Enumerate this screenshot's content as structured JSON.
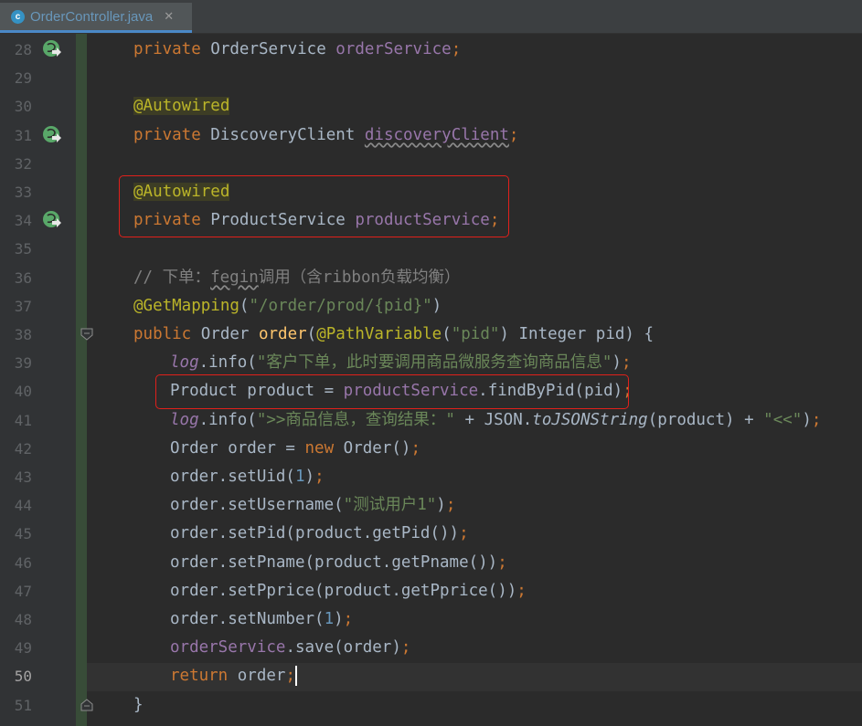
{
  "editor": {
    "tab": {
      "filename": "OrderController.java",
      "icon_letter": "c",
      "close_glyph": "✕"
    },
    "active_line": "50",
    "lines": [
      {
        "n": "28",
        "parts": [
          [
            "kw",
            "private "
          ],
          [
            "",
            "OrderService "
          ],
          [
            "field",
            "orderService"
          ],
          [
            "kw",
            ";"
          ]
        ]
      },
      {
        "n": "29",
        "parts": []
      },
      {
        "n": "30",
        "parts": [
          [
            "ann annbg",
            "@Autowired"
          ]
        ]
      },
      {
        "n": "31",
        "parts": [
          [
            "kw",
            "private "
          ],
          [
            "",
            "DiscoveryClient "
          ],
          [
            "field sq",
            "discoveryClient"
          ],
          [
            "kw",
            ";"
          ]
        ]
      },
      {
        "n": "32",
        "parts": []
      },
      {
        "n": "33",
        "parts": [
          [
            "ann annbg",
            "@Autowired"
          ]
        ]
      },
      {
        "n": "34",
        "parts": [
          [
            "kw",
            "private "
          ],
          [
            "",
            "ProductService "
          ],
          [
            "field",
            "productService"
          ],
          [
            "kw",
            ";"
          ]
        ]
      },
      {
        "n": "35",
        "parts": []
      },
      {
        "n": "36",
        "parts": [
          [
            "cmt",
            "// 下单："
          ],
          [
            "cmt sq",
            "fegin"
          ],
          [
            "cmt",
            "调用（含ribbon负载均衡）"
          ]
        ]
      },
      {
        "n": "37",
        "parts": [
          [
            "ann",
            "@GetMapping"
          ],
          [
            "",
            "("
          ],
          [
            "str",
            "\"/order/prod/{pid}\""
          ],
          [
            "",
            ")"
          ]
        ]
      },
      {
        "n": "38",
        "parts": [
          [
            "kw",
            "public "
          ],
          [
            "",
            "Order "
          ],
          [
            "fn",
            "order"
          ],
          [
            "",
            "("
          ],
          [
            "ann",
            "@PathVariable"
          ],
          [
            "",
            "("
          ],
          [
            "str",
            "\"pid\""
          ],
          [
            "",
            ") Integer pid) {"
          ]
        ]
      },
      {
        "n": "39",
        "indent": 2,
        "parts": [
          [
            "log",
            "log"
          ],
          [
            "",
            ".info("
          ],
          [
            "str",
            "\"客户下单，此时要调用商品微服务查询商品信息\""
          ],
          [
            "",
            ")"
          ],
          [
            "kw",
            ";"
          ]
        ]
      },
      {
        "n": "40",
        "indent": 2,
        "parts": [
          [
            "",
            "Product product = "
          ],
          [
            "field",
            "productService"
          ],
          [
            "",
            ".findByPid(pid)"
          ],
          [
            "kw",
            ";"
          ]
        ]
      },
      {
        "n": "41",
        "indent": 2,
        "parts": [
          [
            "log",
            "log"
          ],
          [
            "",
            ".info("
          ],
          [
            "str",
            "\">>商品信息，查询结果：\""
          ],
          [
            "",
            " + JSON."
          ],
          [
            "ital",
            "toJSONString"
          ],
          [
            "",
            "(product) + "
          ],
          [
            "str",
            "\"<<\""
          ],
          [
            "",
            ")"
          ],
          [
            "kw",
            ";"
          ]
        ]
      },
      {
        "n": "42",
        "indent": 2,
        "parts": [
          [
            "",
            "Order order = "
          ],
          [
            "kw",
            "new "
          ],
          [
            "",
            "Order()"
          ],
          [
            "kw",
            ";"
          ]
        ]
      },
      {
        "n": "43",
        "indent": 2,
        "parts": [
          [
            "",
            "order.setUid("
          ],
          [
            "num",
            "1"
          ],
          [
            "",
            ")"
          ],
          [
            "kw",
            ";"
          ]
        ]
      },
      {
        "n": "44",
        "indent": 2,
        "parts": [
          [
            "",
            "order.setUsername("
          ],
          [
            "str",
            "\"测试用户1\""
          ],
          [
            "",
            ")"
          ],
          [
            "kw",
            ";"
          ]
        ]
      },
      {
        "n": "45",
        "indent": 2,
        "parts": [
          [
            "",
            "order.setPid(product.getPid())"
          ],
          [
            "kw",
            ";"
          ]
        ]
      },
      {
        "n": "46",
        "indent": 2,
        "parts": [
          [
            "",
            "order.setPname(product.getPname())"
          ],
          [
            "kw",
            ";"
          ]
        ]
      },
      {
        "n": "47",
        "indent": 2,
        "parts": [
          [
            "",
            "order.setPprice(product.getPprice())"
          ],
          [
            "kw",
            ";"
          ]
        ]
      },
      {
        "n": "48",
        "indent": 2,
        "parts": [
          [
            "",
            "order.setNumber("
          ],
          [
            "num",
            "1"
          ],
          [
            "",
            ")"
          ],
          [
            "kw",
            ";"
          ]
        ]
      },
      {
        "n": "49",
        "indent": 2,
        "parts": [
          [
            "field",
            "orderService"
          ],
          [
            "",
            ".save(order)"
          ],
          [
            "kw",
            ";"
          ]
        ]
      },
      {
        "n": "50",
        "indent": 2,
        "cursor": true,
        "parts": [
          [
            "kw",
            "return "
          ],
          [
            "",
            "order"
          ],
          [
            "kw",
            ";"
          ]
        ]
      },
      {
        "n": "51",
        "parts": [
          [
            "",
            "}"
          ]
        ]
      }
    ],
    "gutter_icons": [
      {
        "line": "28",
        "icon": "spring-bean-autowired-icon"
      },
      {
        "line": "31",
        "icon": "spring-bean-autowired-icon"
      },
      {
        "line": "34",
        "icon": "spring-bean-autowired-icon"
      }
    ],
    "fold_markers": [
      {
        "line": "38",
        "icon": "fold-start-icon"
      },
      {
        "line": "51",
        "icon": "fold-end-icon"
      }
    ],
    "highlight_boxes": [
      {
        "from_line": "33",
        "to_line": "34",
        "color": "#e0201b"
      },
      {
        "from_line": "40",
        "to_line": "40",
        "color": "#e0201b"
      }
    ],
    "colors": {
      "background": "#2b2b2b",
      "keyword": "#cc7832",
      "field": "#9876aa",
      "annotation": "#bbb529",
      "string": "#6a8759",
      "comment": "#808080",
      "method_decl": "#ffc66d",
      "highlight_box": "#e0201b"
    }
  }
}
